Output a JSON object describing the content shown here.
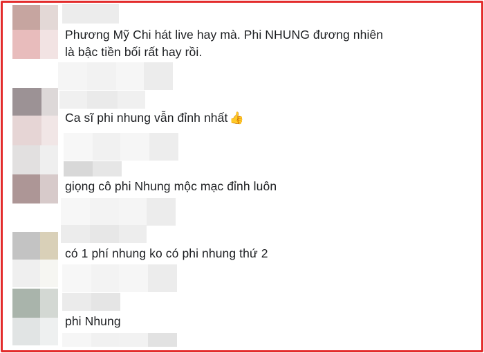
{
  "comments": [
    {
      "text": "Phương Mỹ Chi hát live hay mà. Phi NHUNG đương nhiên là bậc tiền bối rất hay rồi."
    },
    {
      "text": "Ca sĩ phi nhung vẫn đỉnh nhất",
      "emoji": "👍"
    },
    {
      "text": "giọng cô phi Nhung mộc mạc đỉnh luôn"
    },
    {
      "text": "có 1 phí nhung ko có phi nhung thứ 2"
    },
    {
      "text": "phi Nhung"
    }
  ],
  "colors": {
    "frame": "#e32b2b",
    "text": "#1c1e21"
  },
  "icons": {
    "thumbs_up": "thumbs-up-emoji-icon"
  }
}
